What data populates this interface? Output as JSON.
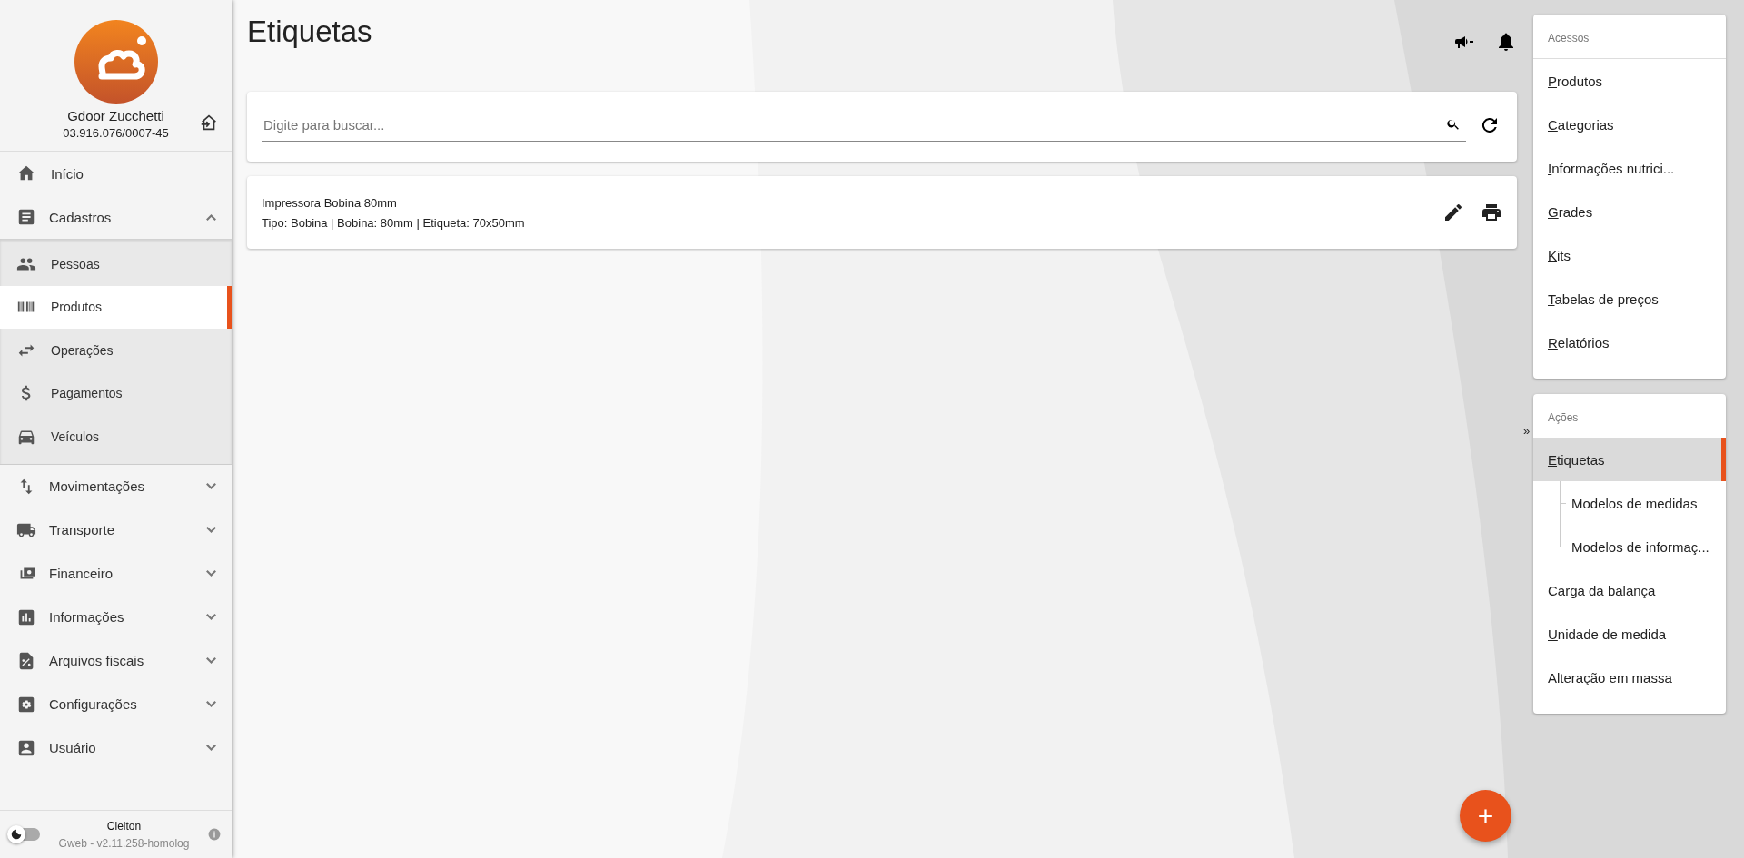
{
  "company": {
    "name": "Gdoor Zucchetti",
    "document": "03.916.076/0007-45"
  },
  "nav": [
    {
      "kind": "link",
      "label": "Início"
    },
    {
      "kind": "group",
      "label": "Cadastros",
      "expanded": true,
      "children": [
        {
          "label": "Pessoas",
          "selected": false
        },
        {
          "label": "Produtos",
          "selected": true
        },
        {
          "label": "Operações",
          "selected": false
        },
        {
          "label": "Pagamentos",
          "selected": false
        },
        {
          "label": "Veículos",
          "selected": false
        }
      ]
    },
    {
      "kind": "group",
      "label": "Movimentações",
      "expanded": false
    },
    {
      "kind": "group",
      "label": "Transporte",
      "expanded": false
    },
    {
      "kind": "group",
      "label": "Financeiro",
      "expanded": false
    },
    {
      "kind": "group",
      "label": "Informações",
      "expanded": false
    },
    {
      "kind": "group",
      "label": "Arquivos fiscais",
      "expanded": false
    },
    {
      "kind": "group",
      "label": "Configurações",
      "expanded": false
    },
    {
      "kind": "group",
      "label": "Usuário",
      "expanded": false
    }
  ],
  "footer": {
    "user": "Cleiton",
    "version": "Gweb - v2.11.258-homolog",
    "dark_mode": false
  },
  "page": {
    "title": "Etiquetas"
  },
  "search": {
    "placeholder": "Digite para buscar..."
  },
  "items": [
    {
      "title": "Impressora Bobina 80mm",
      "details": "Tipo: Bobina | Bobina: 80mm | Etiqueta: 70x50mm"
    }
  ],
  "panel": {
    "toggle": "»",
    "sections": [
      {
        "heading": "Acessos",
        "items": [
          {
            "hotkey": "P",
            "after": "rodutos",
            "selected": false
          },
          {
            "hotkey": "C",
            "after": "ategorias",
            "selected": false
          },
          {
            "hotkey": "I",
            "after": "nformações nutrici...",
            "selected": false
          },
          {
            "hotkey": "G",
            "after": "rades",
            "selected": false
          },
          {
            "hotkey": "K",
            "after": "its",
            "selected": false
          },
          {
            "hotkey": "T",
            "after": "abelas de preços",
            "selected": false
          },
          {
            "hotkey": "R",
            "after": "elatórios",
            "selected": false
          }
        ]
      },
      {
        "heading": "Ações",
        "items": [
          {
            "hotkey": "E",
            "after": "tiquetas",
            "selected": true,
            "children": [
              {
                "label": "Modelos de medidas"
              },
              {
                "label": "Modelos de informaç..."
              }
            ]
          },
          {
            "before": "Carga da ",
            "hotkey": "b",
            "after": "alança",
            "selected": false
          },
          {
            "hotkey": "U",
            "after": "nidade de medida",
            "selected": false
          },
          {
            "before": "Alteração em massa",
            "selected": false
          }
        ]
      }
    ]
  },
  "fab": {
    "label": "+"
  }
}
